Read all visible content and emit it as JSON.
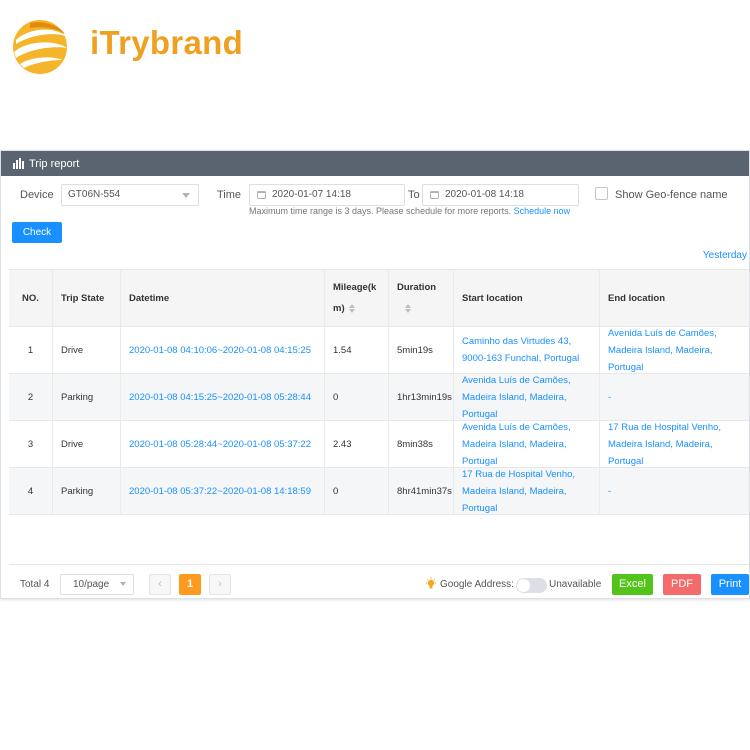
{
  "brand": {
    "name": "iTrybrand",
    "accent": "#f0a020"
  },
  "panel": {
    "title": "Trip report",
    "icon": "bar-chart-icon"
  },
  "filters": {
    "device_label": "Device",
    "device_value": "GT06N-554",
    "time_label": "Time",
    "time_from": "2020-01-07 14:18",
    "to_label": "To",
    "time_to": "2020-01-08 14:18",
    "geofence_label": "Show Geo-fence name",
    "geofence_checked": false,
    "hint": "Maximum time range is 3 days. Please schedule for more reports.",
    "schedule_link": "Schedule now"
  },
  "check_button": "Check",
  "quick_range": "Yesterday",
  "table": {
    "columns": [
      "NO.",
      "Trip State",
      "Datetime",
      "Mileage(km)",
      "Duration",
      "Start location",
      "End location"
    ],
    "mileage_header_lines": [
      "Mileage(k",
      "m)"
    ],
    "rows": [
      {
        "no": "1",
        "state": "Drive",
        "datetime": "2020-01-08 04:10:06~2020-01-08 04:15:25",
        "mileage": "1.54",
        "duration": "5min19s",
        "start": "Caminho das Virtudes 43, 9000-163 Funchal, Portugal",
        "end": "Avenida Luís de Camões, Madeira Island, Madeira, Portugal"
      },
      {
        "no": "2",
        "state": "Parking",
        "datetime": "2020-01-08 04:15:25~2020-01-08 05:28:44",
        "mileage": "0",
        "duration": "1hr13min19s",
        "start": "Avenida Luís de Camões, Madeira Island, Madeira, Portugal",
        "end": "-"
      },
      {
        "no": "3",
        "state": "Drive",
        "datetime": "2020-01-08 05:28:44~2020-01-08 05:37:22",
        "mileage": "2.43",
        "duration": "8min38s",
        "start": "Avenida Luís de Camões, Madeira Island, Madeira, Portugal",
        "end": "17 Rua de Hospital Venho, Madeira Island, Madeira, Portugal"
      },
      {
        "no": "4",
        "state": "Parking",
        "datetime": "2020-01-08 05:37:22~2020-01-08 14:18:59",
        "mileage": "0",
        "duration": "8hr41min37s",
        "start": "17 Rua de Hospital Venho, Madeira Island, Madeira, Portugal",
        "end": "-"
      }
    ]
  },
  "footer": {
    "total": "Total 4",
    "page_size": "10/page",
    "prev": "‹",
    "current_page": "1",
    "next": "›",
    "google_address_label": "Google Address:",
    "google_address_enabled": false,
    "unavailable": "Unavailable",
    "excel": "Excel",
    "pdf": "PDF",
    "print": "Print"
  },
  "colors": {
    "primary": "#1890ff",
    "excel": "#52c41a",
    "pdf": "#f46b6b",
    "page_active": "#ff9a1f",
    "header_bar": "#5a6470"
  }
}
